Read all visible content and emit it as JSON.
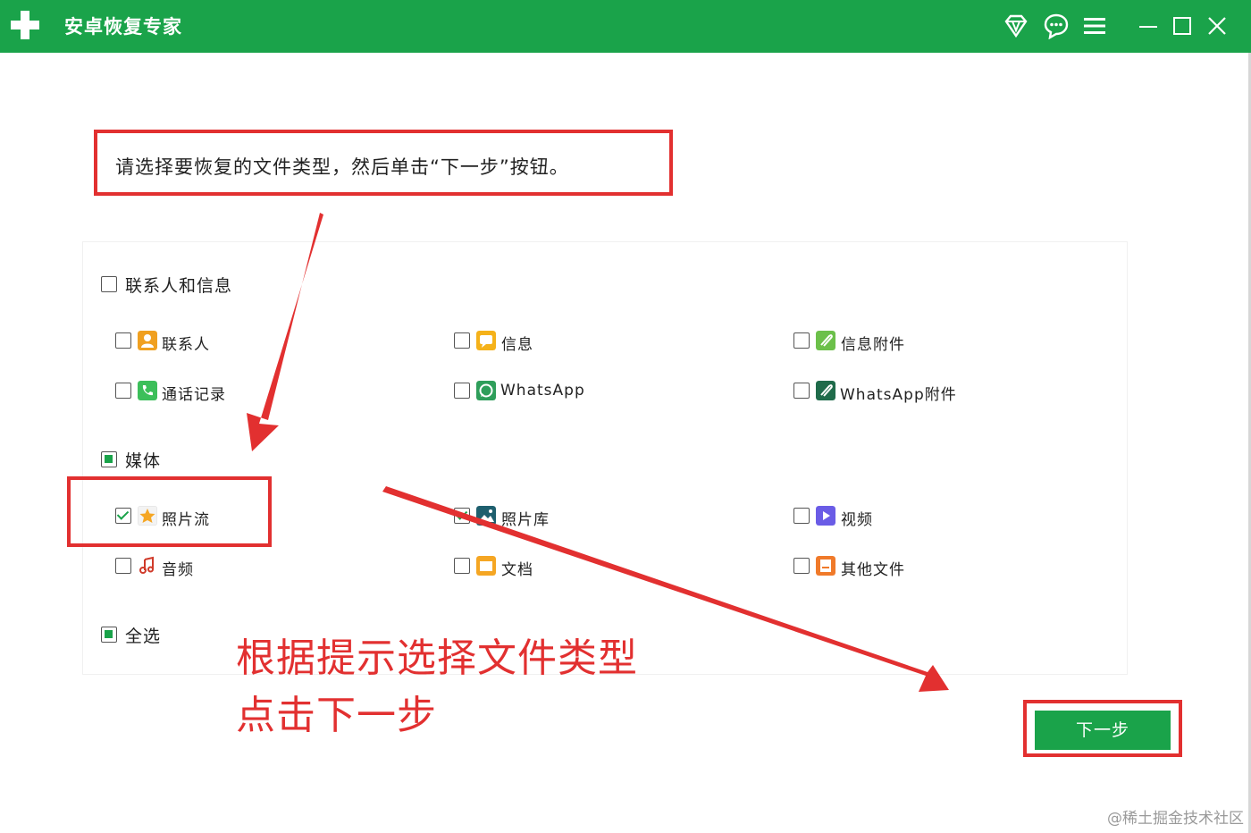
{
  "app": {
    "title": "安卓恢复专家"
  },
  "instruction": "请选择要恢复的文件类型，然后单击“下一步”按钮。",
  "groups": [
    {
      "label": "联系人和信息",
      "state": "unchecked",
      "items": [
        {
          "label": "联系人",
          "state": "unchecked",
          "icon": "contacts-icon"
        },
        {
          "label": "信息",
          "state": "unchecked",
          "icon": "messages-icon"
        },
        {
          "label": "信息附件",
          "state": "unchecked",
          "icon": "message-attachments-icon"
        },
        {
          "label": "通话记录",
          "state": "unchecked",
          "icon": "call-log-icon"
        },
        {
          "label": "WhatsApp",
          "state": "unchecked",
          "icon": "whatsapp-icon"
        },
        {
          "label": "WhatsApp附件",
          "state": "unchecked",
          "icon": "whatsapp-attachments-icon"
        }
      ]
    },
    {
      "label": "媒体",
      "state": "partial",
      "items": [
        {
          "label": "照片流",
          "state": "checked",
          "icon": "photo-stream-icon"
        },
        {
          "label": "照片库",
          "state": "checked",
          "icon": "photo-library-icon"
        },
        {
          "label": "视频",
          "state": "unchecked",
          "icon": "video-icon"
        },
        {
          "label": "音频",
          "state": "unchecked",
          "icon": "audio-icon"
        },
        {
          "label": "文档",
          "state": "unchecked",
          "icon": "documents-icon"
        },
        {
          "label": "其他文件",
          "state": "unchecked",
          "icon": "other-files-icon"
        }
      ]
    }
  ],
  "select_all": {
    "label": "全选",
    "state": "partial"
  },
  "annotation": {
    "line1": "根据提示选择文件类型",
    "line2": "点击下一步"
  },
  "next_button": "下一步",
  "watermark": "@稀土掘金技术社区",
  "colors": {
    "brand_green": "#1aa34a",
    "annotation_red": "#e23030"
  }
}
